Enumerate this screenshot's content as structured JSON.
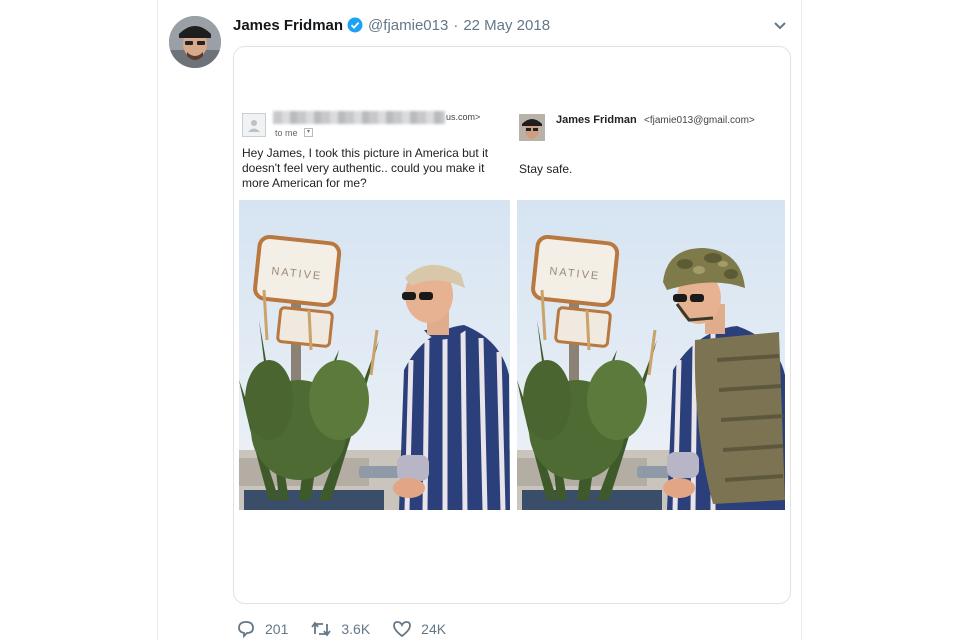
{
  "tweet": {
    "author_name": "James Fridman",
    "handle": "@fjamie013",
    "separator": "·",
    "date": "22 May 2018",
    "icons": {
      "verified": "verified-badge-icon",
      "menu": "chevron-down-icon"
    },
    "accent_color": "#1da1f2"
  },
  "email_left": {
    "sender_domain": "us.com>",
    "to_label": "to me",
    "message": "Hey James, I took this picture in America but it doesn't feel very authentic.. could you make it more American for me?"
  },
  "email_right": {
    "sender_name": "James Fridman",
    "sender_email": "<fjamie013@gmail.com>",
    "message": "Stay safe."
  },
  "photo": {
    "sign_text": "NATIVE"
  },
  "actions": {
    "reply_count": "201",
    "retweet_count": "3.6K",
    "like_count": "24K"
  }
}
